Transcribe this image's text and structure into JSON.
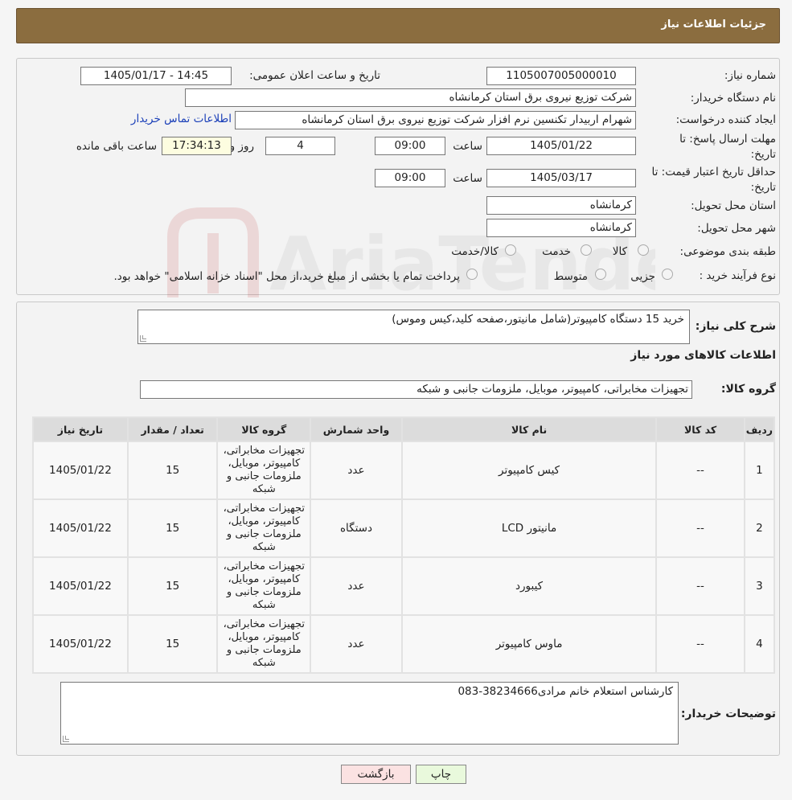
{
  "header": {
    "title": "جزئیات اطلاعات نیاز"
  },
  "watermark": {
    "text": "AriaTender.neT"
  },
  "info": {
    "need_number_label": "شماره نیاز:",
    "need_number": "1105007005000010",
    "announce_label": "تاریخ و ساعت اعلان عمومی:",
    "announce_value": "1405/01/17 - 14:45",
    "buyer_label": "نام دستگاه خریدار:",
    "buyer_value": "شرکت توزیع نیروی برق استان کرمانشاه",
    "creator_label": "ایجاد کننده درخواست:",
    "creator_value": "شهرام اربیدار تکنسین نرم افزار شرکت توزیع نیروی برق استان کرمانشاه",
    "contact_link": "اطلاعات تماس خریدار",
    "deadline_label_1": "مهلت ارسال پاسخ: تا",
    "deadline_label_2": "تاریخ:",
    "deadline_date": "1405/01/22",
    "time_label": "ساعت",
    "deadline_time": "09:00",
    "days_value": "4",
    "days_label": "روز و",
    "remaining_time": "17:34:13",
    "remaining_label": "ساعت باقی مانده",
    "validity_label_1": "حداقل تاریخ اعتبار قیمت: تا",
    "validity_label_2": "تاریخ:",
    "validity_date": "1405/03/17",
    "validity_time": "09:00",
    "province_label": "استان محل تحویل:",
    "province_value": "کرمانشاه",
    "city_label": "شهر محل تحویل:",
    "city_value": "کرمانشاه",
    "category_label": "طبقه بندی موضوعی:",
    "category_options": [
      "کالا",
      "خدمت",
      "کالا/خدمت"
    ],
    "process_label": "نوع فرآیند خرید :",
    "process_options": [
      "جزیی",
      "متوسط"
    ],
    "process_note": "پرداخت تمام یا بخشی از مبلغ خرید،از محل \"اسناد خزانه اسلامی\" خواهد بود."
  },
  "description": {
    "label": "شرح کلی نیاز:",
    "value": "خرید 15 دستگاه کامپیوتر(شامل مانیتور،صفحه کلید،کیس وموس)"
  },
  "goods": {
    "section_title": "اطلاعات کالاهای مورد نیاز",
    "group_label": "گروه کالا:",
    "group_value": "تجهیزات مخابراتی، کامپیوتر، موبایل، ملزومات جانبی و شبکه"
  },
  "table": {
    "headers": [
      "ردیف",
      "کد کالا",
      "نام کالا",
      "واحد شمارش",
      "گروه کالا",
      "تعداد / مقدار",
      "تاریخ نیاز"
    ],
    "rows": [
      [
        "1",
        "--",
        "کیس کامپیوتر",
        "عدد",
        "تجهیزات مخابراتی، کامپیوتر، موبایل، ملزومات جانبی و شبکه",
        "15",
        "1405/01/22"
      ],
      [
        "2",
        "--",
        "مانیتور LCD",
        "دستگاه",
        "تجهیزات مخابراتی، کامپیوتر، موبایل، ملزومات جانبی و شبکه",
        "15",
        "1405/01/22"
      ],
      [
        "3",
        "--",
        "کیبورد",
        "عدد",
        "تجهیزات مخابراتی، کامپیوتر، موبایل، ملزومات جانبی و شبکه",
        "15",
        "1405/01/22"
      ],
      [
        "4",
        "--",
        "ماوس کامپیوتر",
        "عدد",
        "تجهیزات مخابراتی، کامپیوتر، موبایل، ملزومات جانبی و شبکه",
        "15",
        "1405/01/22"
      ]
    ]
  },
  "buyer_notes": {
    "label": "توضیحات خریدار:",
    "value": "کارشناس استعلام خانم مرادی38234666-083"
  },
  "buttons": {
    "print": "چاپ",
    "back": "بازگشت"
  },
  "colors": {
    "header": "#8b6d3f",
    "print_btn": "#e9f9dc",
    "back_btn": "#fbe2e2"
  }
}
